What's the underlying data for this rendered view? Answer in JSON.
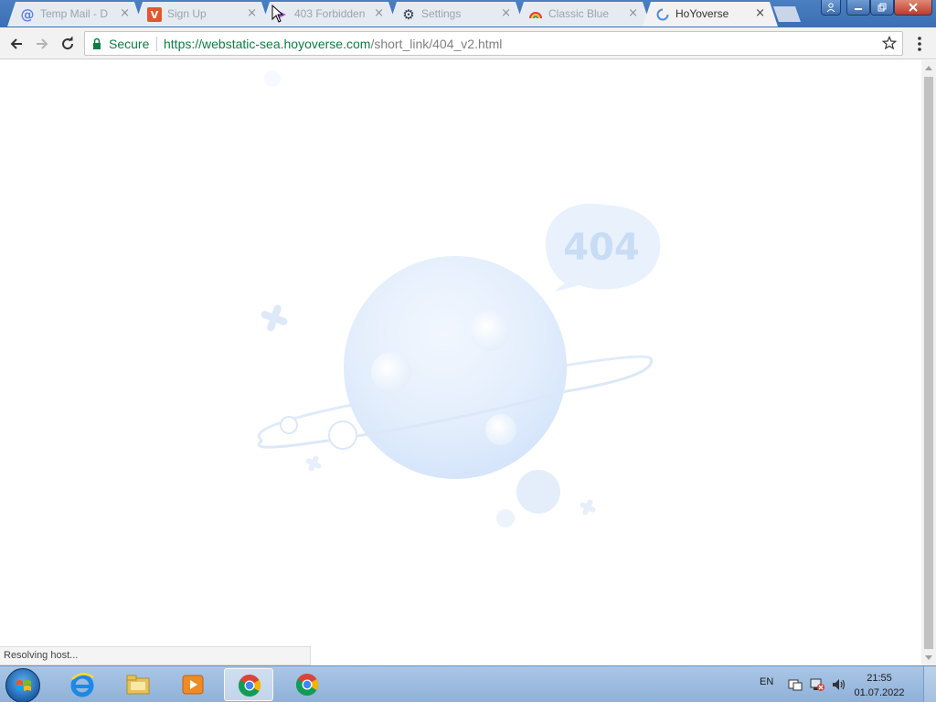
{
  "tabs": [
    {
      "title": "Temp Mail - D",
      "icon": "at-icon",
      "active": false
    },
    {
      "title": "Sign Up",
      "icon": "v-logo-icon",
      "active": false
    },
    {
      "title": "403 Forbidden",
      "icon": "hoyoverse-icon",
      "active": false
    },
    {
      "title": "Settings",
      "icon": "gear-icon",
      "active": false
    },
    {
      "title": "Classic Blue",
      "icon": "rainbow-icon",
      "active": false
    },
    {
      "title": "HoYoverse",
      "icon": "loading-spinner-icon",
      "active": true
    }
  ],
  "close_glyph": "×",
  "omnibox": {
    "secure_label": "Secure",
    "url_host": "https://webstatic-sea.hoyoverse.com",
    "url_path": "/short_link/404_v2.html"
  },
  "page": {
    "error_code": "404"
  },
  "status_text": "Resolving host...",
  "taskbar": {
    "language": "EN",
    "time": "21:55",
    "date": "01.07.2022",
    "apps": [
      "internet-explorer-icon",
      "explorer-folder-icon",
      "media-player-icon",
      "chrome-icon",
      "chrome-icon"
    ]
  },
  "colors": {
    "secure_green": "#0b8043",
    "titlebar_blue": "#3b6fb3",
    "planet_blue": "#dce9fb"
  }
}
